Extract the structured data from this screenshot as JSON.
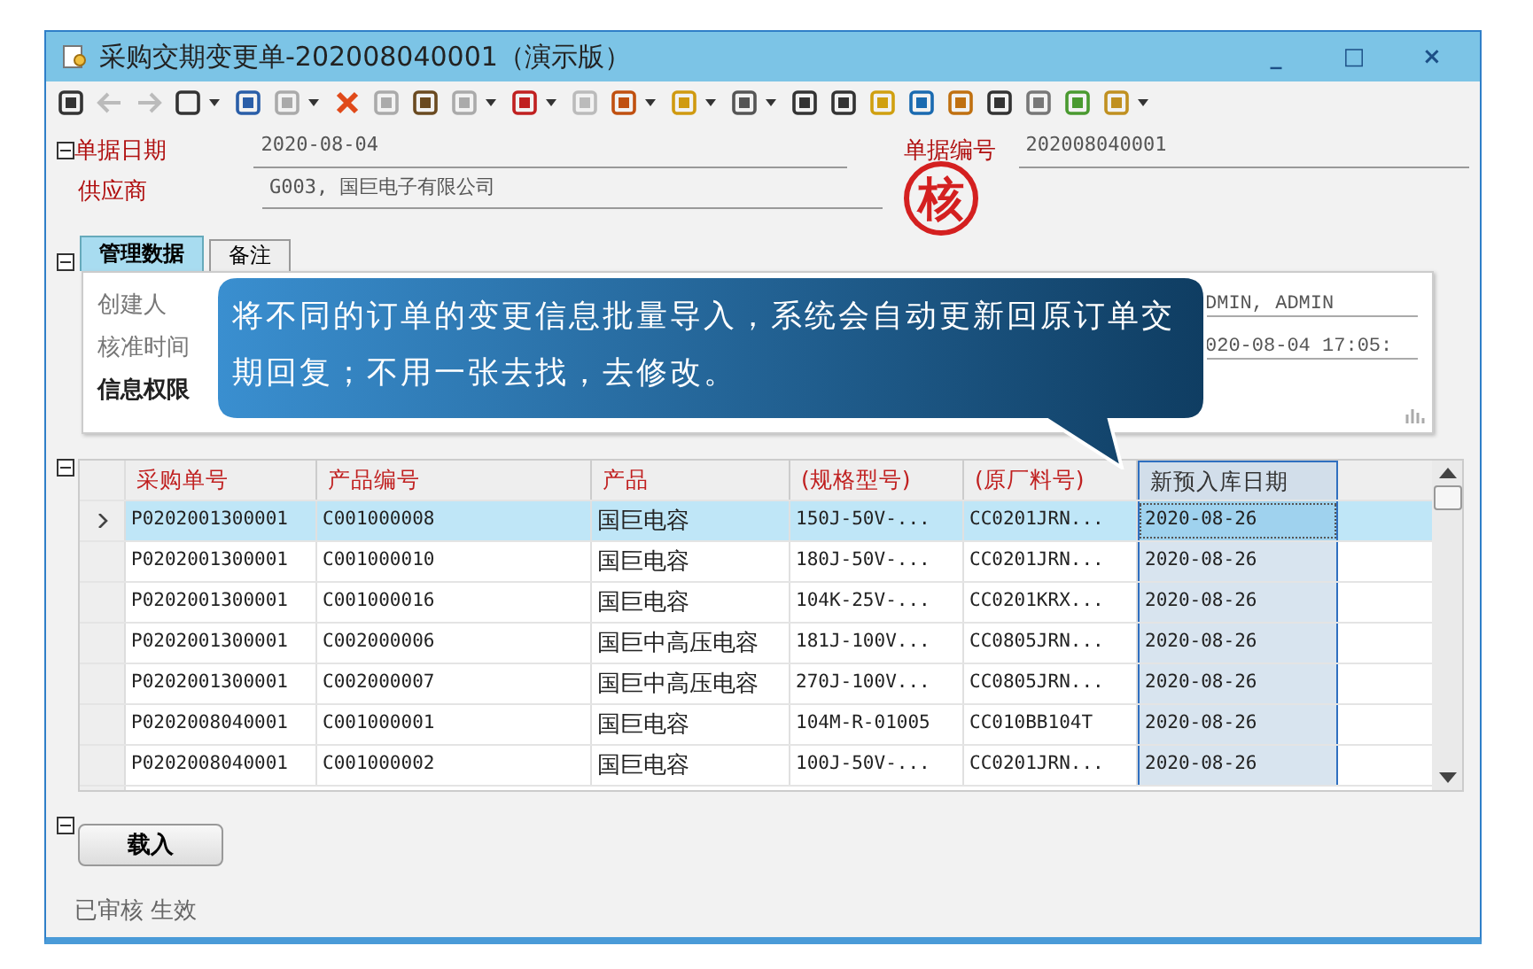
{
  "window": {
    "title": "采购交期变更单-202008040001（演示版）",
    "controls": [
      "_",
      "□",
      "×"
    ]
  },
  "header": {
    "fields": [
      {
        "label": "单据日期",
        "value": "2020-08-04"
      },
      {
        "label": "单据编号",
        "value": "202008040001"
      },
      {
        "label": "供应商",
        "value": "G003, 国巨电子有限公司"
      }
    ],
    "stamp": "核"
  },
  "tabs": [
    {
      "label": "管理数据",
      "selected": true
    },
    {
      "label": "备注",
      "selected": false
    }
  ],
  "panel": {
    "fields": [
      {
        "label": "创建人",
        "value": "DMIN, ADMIN"
      },
      {
        "label": "核准时间",
        "value": "020-08-04 17:05:"
      },
      {
        "label": "信息权限"
      }
    ]
  },
  "tooltip": {
    "text": "将不同的订单的变更信息批量导入，系统会自动更新回原订单交期回复；不用一张去找，去修改。"
  },
  "table": {
    "columns": [
      {
        "label": "采购单号",
        "selected": false
      },
      {
        "label": "产品编号",
        "selected": false
      },
      {
        "label": "产品",
        "selected": false
      },
      {
        "label": "(规格型号)",
        "selected": false
      },
      {
        "label": "(原厂料号)",
        "selected": false
      },
      {
        "label": "新预入库日期",
        "selected": true
      }
    ],
    "rows": [
      {
        "selected": true,
        "cells": [
          "P0202001300001",
          "C001000008",
          "国巨电容",
          "150J-50V-...",
          "CC0201JRN...",
          "2020-08-26"
        ]
      },
      {
        "selected": false,
        "cells": [
          "P0202001300001",
          "C001000010",
          "国巨电容",
          "180J-50V-...",
          "CC0201JRN...",
          "2020-08-26"
        ]
      },
      {
        "selected": false,
        "cells": [
          "P0202001300001",
          "C001000016",
          "国巨电容",
          "104K-25V-...",
          "CC0201KRX...",
          "2020-08-26"
        ]
      },
      {
        "selected": false,
        "cells": [
          "P0202001300001",
          "C002000006",
          "国巨中高压电容",
          "181J-100V...",
          "CC0805JRN...",
          "2020-08-26"
        ]
      },
      {
        "selected": false,
        "cells": [
          "P0202001300001",
          "C002000007",
          "国巨中高压电容",
          "270J-100V...",
          "CC0805JRN...",
          "2020-08-26"
        ]
      },
      {
        "selected": false,
        "cells": [
          "P0202008040001",
          "C001000001",
          "国巨电容",
          "104M-R-01005",
          "CC010BB104T",
          "2020-08-26"
        ]
      },
      {
        "selected": false,
        "cells": [
          "P0202008040001",
          "C001000002",
          "国巨电容",
          "100J-50V-...",
          "CC0201JRN...",
          "2020-08-26"
        ]
      }
    ]
  },
  "load_button": "载入",
  "status": "已审核 生效"
}
